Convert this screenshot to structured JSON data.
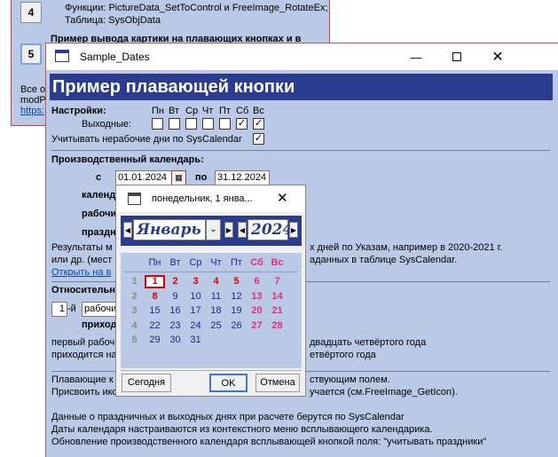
{
  "bg": {
    "row4": {
      "num": "4",
      "line1": "Функции: PictureData_SetToControl и FreeImage_RotateEx;",
      "line2": "Таблица: SysObjData"
    },
    "row5": {
      "num": "5",
      "text": "Пример вывода картики на плавающих кнопках и в контекстном меню."
    },
    "frag1": "Все ос",
    "frag2": "modPi",
    "frag3": "https:"
  },
  "main": {
    "title": "Sample_Dates",
    "header": "Пример плавающей кнопки",
    "settings_label": "Настройки:",
    "days": [
      "Пн",
      "Вт",
      "Ср",
      "Чт",
      "Пт",
      "Сб",
      "Вс"
    ],
    "weekends_label": "Выходные:",
    "weekends_checked": [
      false,
      false,
      false,
      false,
      false,
      true,
      true
    ],
    "syscal_label": "Учитывать нерабочие дни по SysCalendar",
    "syscal_checked": true,
    "prod_cal_label": "Производственный календарь:",
    "from_label": "с",
    "from_value": "01.01.2024",
    "to_label": "по",
    "to_value": "31.12.2024",
    "frag_calend": "календ",
    "frag_rabochi": "рабочи",
    "frag_prazd": "праздн",
    "results_l1a": "Результаты м",
    "results_l1b": "х дней по Указам, например в 2020-2021 г.",
    "results_l2a": "или др. (мест",
    "results_l2b": "аданных в таблице SysCalendar.",
    "open_link": "Открыть на в",
    "relative_label": "Относительн",
    "n_value": "1",
    "n_suffix": "-й",
    "rab_value": "рабочи",
    "prikhod": "приход",
    "first_l1a": "первый рабоч",
    "first_l1b": "двадцать четвёртого года",
    "first_l2a": "приходится на",
    "first_l2b": "етвёртого года",
    "float_l1a": "Плавающие к",
    "float_l1b": "ствующим полем.",
    "float_l2a": "Присвоить ико",
    "float_l2b": "учается (см.FreeImage_GetIcon).",
    "info1": "Данные о праздничных и выходных днях при расчете берутся по SysCalendar",
    "info2": "Даты календаря настраиваются из контекстного меню всплывающего календарика.",
    "info3": "Обновление производственного календаря всплывающей кнопкой поля: \"учитывать праздники\""
  },
  "cal": {
    "title": "понедельник, 1 янва...",
    "month": "Январь",
    "year": "2024",
    "weekdays": [
      "Пн",
      "Вт",
      "Ср",
      "Чт",
      "Пт",
      "Сб",
      "Вс"
    ],
    "weeks": [
      "1",
      "2",
      "3",
      "4",
      "5"
    ],
    "days": [
      [
        "1",
        "2",
        "3",
        "4",
        "5",
        "6",
        "7"
      ],
      [
        "8",
        "9",
        "10",
        "11",
        "12",
        "13",
        "14"
      ],
      [
        "15",
        "16",
        "17",
        "18",
        "19",
        "20",
        "21"
      ],
      [
        "22",
        "23",
        "24",
        "25",
        "26",
        "27",
        "28"
      ],
      [
        "29",
        "30",
        "31",
        "",
        "",
        "",
        ""
      ]
    ],
    "today_btn": "Сегодня",
    "ok_btn": "OK",
    "cancel_btn": "Отмена",
    "colors": {
      "holiday": "#e00000",
      "weekend": "#e0307a",
      "weekday": "#1a2b8c",
      "weeknum": "#8a8a8a",
      "header": "#2b3c8f"
    }
  }
}
